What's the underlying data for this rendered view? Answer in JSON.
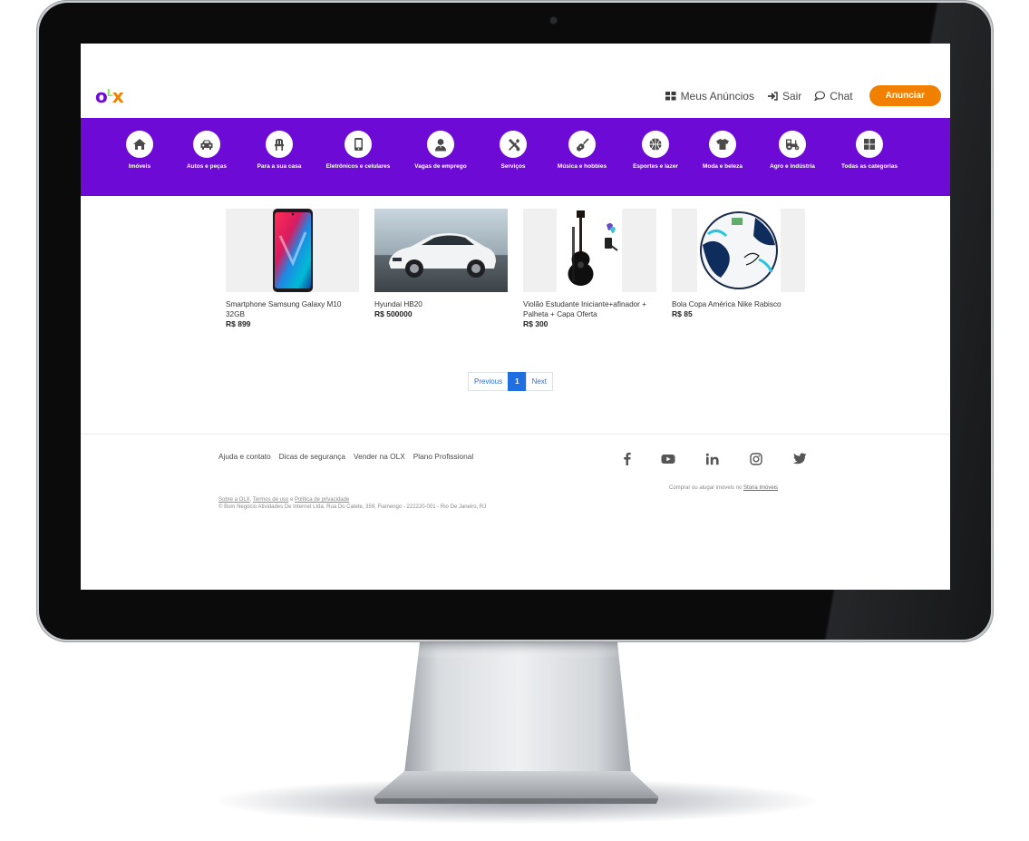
{
  "header": {
    "logo": {
      "o": "o",
      "l": "L",
      "x": "x"
    },
    "nav": {
      "meus_anuncios": "Meus Anúncios",
      "sair": "Sair",
      "chat": "Chat",
      "anunciar": "Anunciar"
    }
  },
  "colors": {
    "brand_purple": "#6e0ad6",
    "brand_orange": "#f28000",
    "pager_active": "#1f6fe0"
  },
  "categories": [
    {
      "label": "Imóveis",
      "icon": "home-icon"
    },
    {
      "label": "Autos e peças",
      "icon": "car-icon"
    },
    {
      "label": "Para a sua casa",
      "icon": "chair-icon"
    },
    {
      "label": "Eletrônicos e celulares",
      "icon": "phone-icon"
    },
    {
      "label": "Vagas de emprego",
      "icon": "worker-icon"
    },
    {
      "label": "Serviços",
      "icon": "tools-icon"
    },
    {
      "label": "Música e hobbies",
      "icon": "guitar-icon"
    },
    {
      "label": "Esportes e lazer",
      "icon": "basketball-icon"
    },
    {
      "label": "Moda e beleza",
      "icon": "shirt-icon"
    },
    {
      "label": "Agro e indústria",
      "icon": "tractor-icon"
    },
    {
      "label": "Todas as categorias",
      "icon": "grid-icon"
    }
  ],
  "products": [
    {
      "title": "Smartphone Samsung Galaxy M10 32GB",
      "price": "R$ 899"
    },
    {
      "title": "Hyundai HB20",
      "price": "R$ 500000"
    },
    {
      "title": "Violão Estudante Iniciante+afinador + Palheta + Capa Oferta",
      "price": "R$ 300"
    },
    {
      "title": "Bola Copa América Nike Rabisco",
      "price": "R$ 85"
    }
  ],
  "pagination": {
    "previous": "Previous",
    "current": "1",
    "next": "Next"
  },
  "footer": {
    "links": [
      "Ajuda e contato",
      "Dicas de segurança",
      "Vender na OLX",
      "Plano Profissional"
    ],
    "social": [
      "facebook-icon",
      "youtube-icon",
      "linkedin-icon",
      "instagram-icon",
      "twitter-icon"
    ],
    "legal": {
      "sobre": "Sobre a OLX",
      "sep1": ", ",
      "termos": "Termos de uso",
      "sep2": " e ",
      "privacidade": "Política de privacidade",
      "copyright": "© Bom Negócio Atividades De Internet Ltda. Rua Do Catete, 359, Flamengo - 222220-001 - Rio De Janeiro, RJ"
    },
    "imoveis_text": "Comprar ou alugar imoveis no ",
    "imoveis_link": "Storia Imóveis"
  }
}
